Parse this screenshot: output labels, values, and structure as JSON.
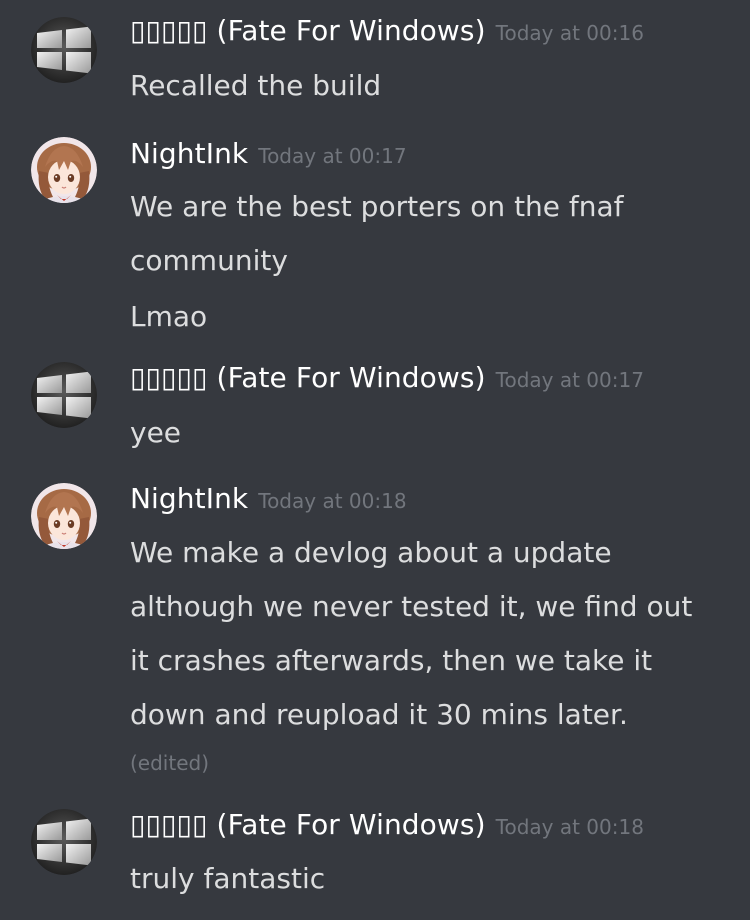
{
  "messages": [
    {
      "author": "▯▯▯▯▯ (Fate For Windows)",
      "timestamp": "Today at 00:16",
      "avatar_icon": "windows-logo-icon",
      "lines": [
        "Recalled the build"
      ]
    },
    {
      "author": "NightInk",
      "timestamp": "Today at 00:17",
      "avatar_icon": "anime-girl-avatar-icon",
      "lines": [
        "We are the best porters on the fnaf",
        "community",
        "Lmao"
      ]
    },
    {
      "author": "▯▯▯▯▯ (Fate For Windows)",
      "timestamp": "Today at 00:17",
      "avatar_icon": "windows-logo-icon",
      "lines": [
        "yee"
      ]
    },
    {
      "author": "NightInk",
      "timestamp": "Today at 00:18",
      "avatar_icon": "anime-girl-avatar-icon",
      "lines": [
        "We make a devlog about a update",
        "although we never tested it, we find out",
        "it crashes afterwards, then we take it",
        "down and reupload it 30 mins later."
      ],
      "edited": "(edited)"
    },
    {
      "author": "▯▯▯▯▯ (Fate For Windows)",
      "timestamp": "Today at 00:18",
      "avatar_icon": "windows-logo-icon",
      "lines": [
        "truly fantastic"
      ]
    }
  ],
  "colors": {
    "background": "#36393f",
    "username": "#ffffff",
    "message_text": "#dcddde",
    "timestamp": "#72767d"
  }
}
